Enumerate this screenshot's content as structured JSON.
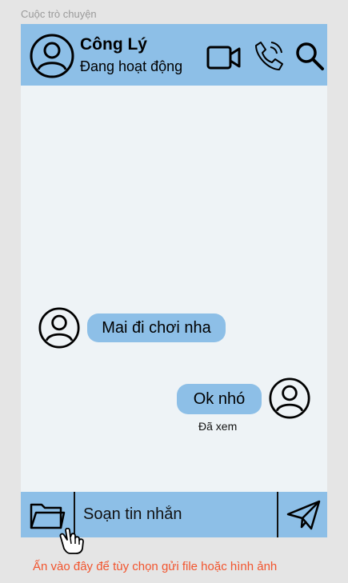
{
  "frame": {
    "label": "Cuộc trò chuyện"
  },
  "header": {
    "avatar_icon": "user-avatar-icon",
    "name": "Công Lý",
    "status": "Đang hoạt động",
    "actions": [
      {
        "id": "video-call",
        "icon": "video-camera-icon"
      },
      {
        "id": "voice-call",
        "icon": "phone-call-icon"
      },
      {
        "id": "search",
        "icon": "search-icon"
      }
    ]
  },
  "messages": [
    {
      "direction": "incoming",
      "text": "Mai đi chơi nha",
      "avatar_icon": "user-avatar-icon"
    },
    {
      "direction": "outgoing",
      "text": "Ok nhó",
      "avatar_icon": "user-avatar-icon",
      "status": "Đã xem"
    }
  ],
  "composer": {
    "attach_icon": "folder-icon",
    "placeholder": "Soạn tin nhắn",
    "value": "",
    "send_icon": "paper-plane-send-icon"
  },
  "annotation": {
    "cursor_icon": "hand-pointer-icon",
    "text": "Ấn vào đây để tùy chọn gửi file hoặc hình ảnh",
    "color": "#f2542d"
  },
  "colors": {
    "accent": "#8dbfe7",
    "chat_background": "#eef3f6",
    "canvas": "#e5e5e5"
  }
}
